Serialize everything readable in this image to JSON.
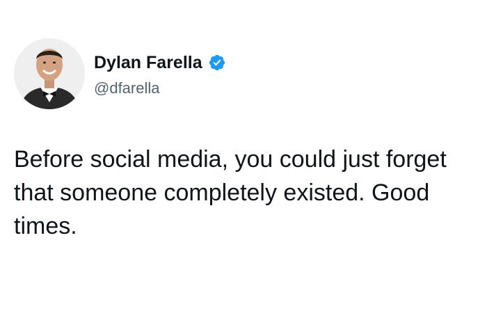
{
  "tweet": {
    "author": {
      "display_name": "Dylan Farella",
      "handle": "@dfarella",
      "verified": true,
      "verified_icon": "verified-badge-icon",
      "avatar": "profile-photo"
    },
    "text": "Before social media, you could just forget that someone completely existed. Good times."
  },
  "colors": {
    "text_primary": "#0f1419",
    "text_secondary": "#536471",
    "verified_blue": "#1d9bf0",
    "background": "#ffffff"
  }
}
